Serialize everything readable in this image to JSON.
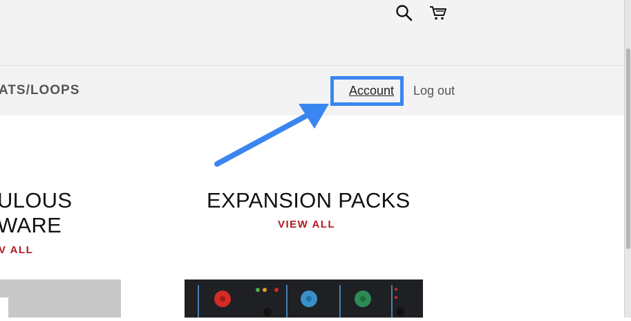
{
  "header": {
    "search_icon": "search-icon",
    "cart_icon": "cart-icon"
  },
  "nav": {
    "beats_label": "ATS/LOOPS",
    "account_label": "Account",
    "logout_label": "Log out"
  },
  "annotation": {
    "highlight_color": "#3a86f0"
  },
  "collections": [
    {
      "title_line1": "ULOUS",
      "title_line2": "WARE",
      "view_all": "V ALL"
    },
    {
      "title_line1": "EXPANSION PACKS",
      "view_all": "VIEW ALL"
    }
  ],
  "colors": {
    "accent": "#b0191e",
    "header_bg": "#f3f3f3"
  }
}
